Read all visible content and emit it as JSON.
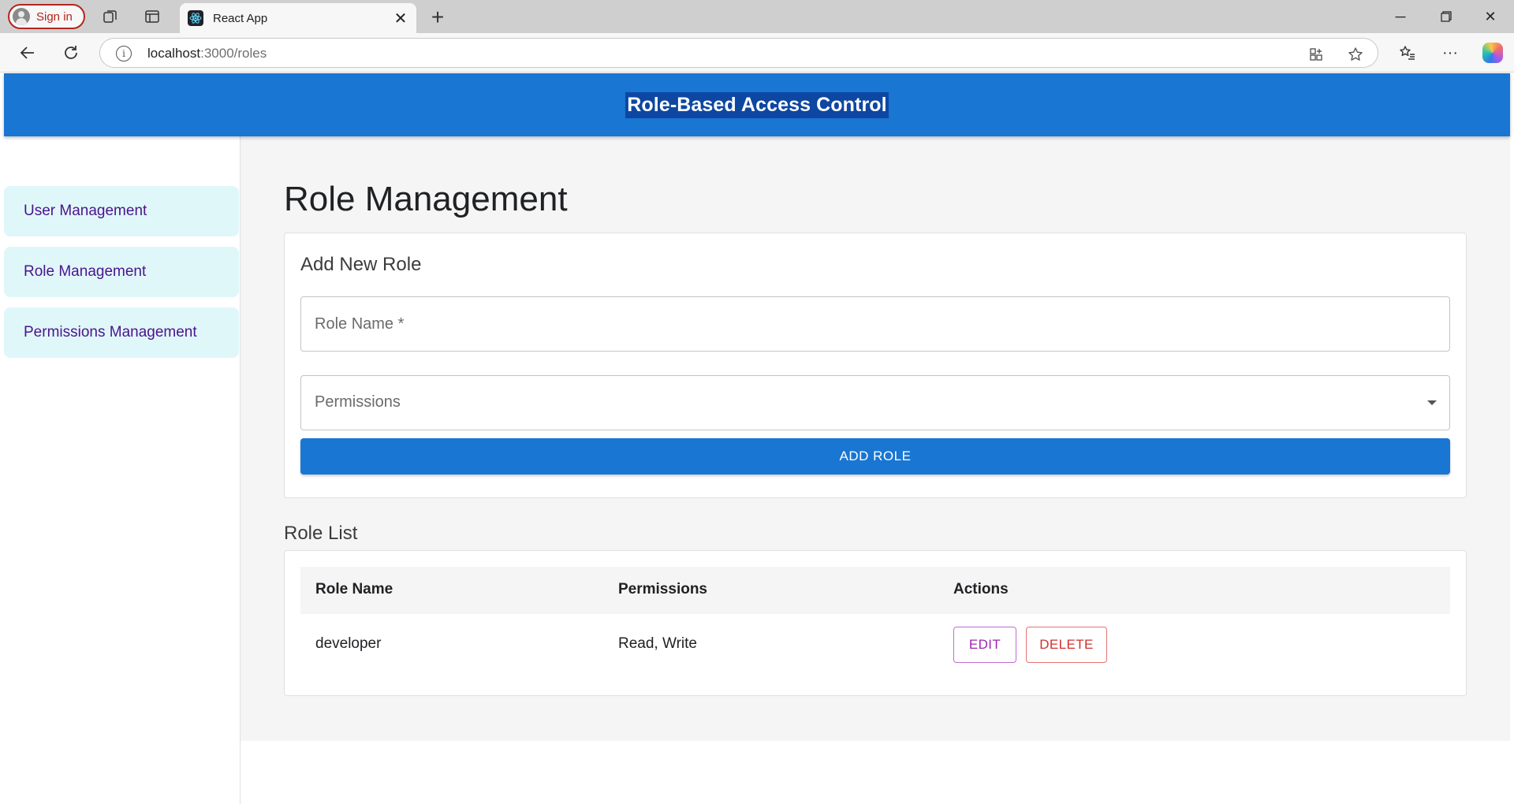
{
  "browser": {
    "signin_label": "Sign in",
    "tab_title": "React App",
    "url_host": "localhost",
    "url_path": ":3000/roles"
  },
  "app": {
    "title": "Role-Based Access Control"
  },
  "sidebar": {
    "items": [
      {
        "label": "User Management"
      },
      {
        "label": "Role Management"
      },
      {
        "label": "Permissions Management"
      }
    ]
  },
  "main": {
    "page_title": "Role Management",
    "add_card": {
      "heading": "Add New Role",
      "role_name_placeholder": "Role Name *",
      "permissions_label": "Permissions",
      "submit_label": "ADD ROLE"
    },
    "role_list": {
      "heading": "Role List",
      "columns": [
        "Role Name",
        "Permissions",
        "Actions"
      ],
      "rows": [
        {
          "role_name": "developer",
          "permissions": "Read, Write",
          "edit_label": "EDIT",
          "delete_label": "DELETE"
        }
      ]
    }
  },
  "colors": {
    "primary": "#1976d2",
    "sidebar_item_bg": "#e0f7fa",
    "sidebar_item_text": "#4a148c",
    "edit": "#9c27b0",
    "delete": "#d32f2f"
  }
}
